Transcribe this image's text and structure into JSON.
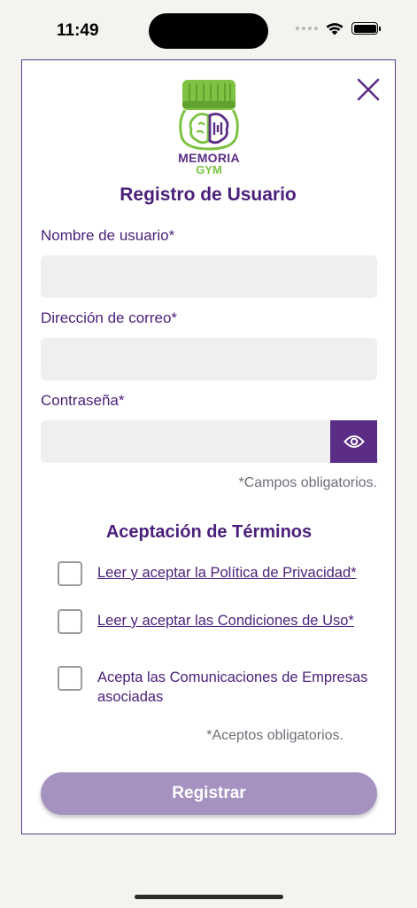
{
  "status_bar": {
    "time": "11:49"
  },
  "logo": {
    "line1": "MEMORIA",
    "line2": "GYM"
  },
  "form": {
    "title": "Registro de Usuario",
    "username": {
      "label": "Nombre de usuario*",
      "value": "",
      "placeholder": ""
    },
    "email": {
      "label": "Dirección de correo*",
      "value": "",
      "placeholder": ""
    },
    "password": {
      "label": "Contraseña*",
      "value": "",
      "placeholder": ""
    },
    "required_note": "*Campos obligatorios."
  },
  "terms": {
    "title": "Aceptación de Términos",
    "privacy": "Leer y aceptar la Política de Privacidad*",
    "conditions": "Leer y aceptar las Condiciones de Uso*",
    "communications": "Acepta las Comunicaciones de Empresas asociadas",
    "required_note": "*Aceptos obligatorios."
  },
  "actions": {
    "register_label": "Registrar"
  },
  "colors": {
    "primary": "#5b2d86",
    "button_disabled": "#a592c1",
    "input_bg": "#efeff1",
    "logo_green": "#7dc242"
  },
  "icons": {
    "close": "close-icon",
    "eye": "eye-icon",
    "wifi": "wifi-icon",
    "battery": "battery-icon",
    "signal": "signal-icon"
  }
}
